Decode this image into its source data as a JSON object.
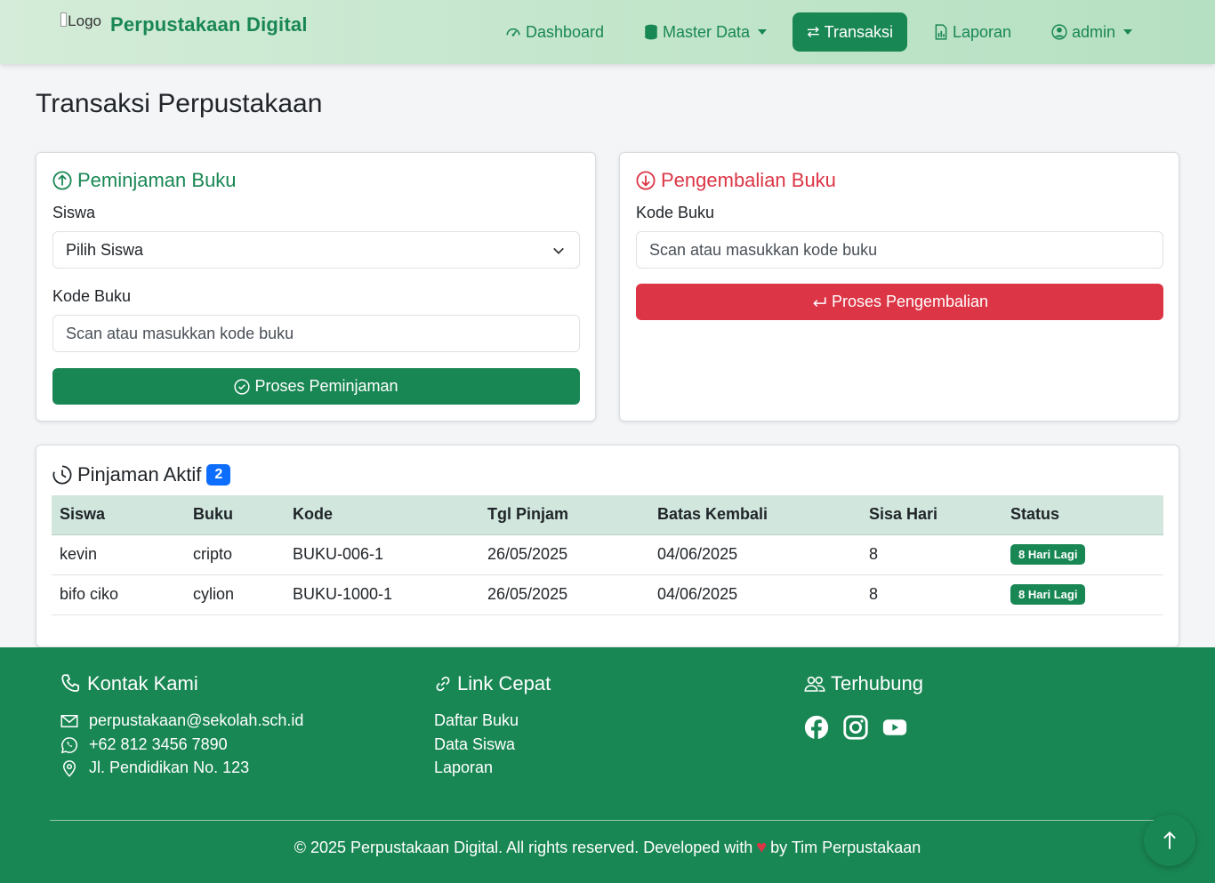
{
  "navbar": {
    "logo_alt": "Logo",
    "brand": "Perpustakaan Digital",
    "items": [
      {
        "label": "Dashboard",
        "icon": "speedometer-icon"
      },
      {
        "label": "Master Data",
        "icon": "database-icon"
      },
      {
        "label": "Transaksi",
        "icon": "arrows-exchange-icon",
        "active": true
      },
      {
        "label": "Laporan",
        "icon": "file-chart-icon"
      },
      {
        "label": "admin",
        "icon": "user-circle-icon"
      }
    ]
  },
  "page": {
    "title": "Transaksi Perpustakaan"
  },
  "borrow": {
    "title": "Peminjaman Buku",
    "student_label": "Siswa",
    "student_value": "Pilih Siswa",
    "code_label": "Kode Buku",
    "code_placeholder": "Scan atau masukkan kode buku",
    "button": "Proses Peminjaman"
  },
  "return": {
    "title": "Pengembalian Buku",
    "code_label": "Kode Buku",
    "code_placeholder": "Scan atau masukkan kode buku",
    "button": "Proses Pengembalian"
  },
  "active_loans": {
    "title": "Pinjaman Aktif",
    "count": "2",
    "headers": [
      "Siswa",
      "Buku",
      "Kode",
      "Tgl Pinjam",
      "Batas Kembali",
      "Sisa Hari",
      "Status"
    ],
    "rows": [
      [
        "kevin",
        "cripto",
        "BUKU-006-1",
        "26/05/2025",
        "04/06/2025",
        "8",
        "8 Hari Lagi"
      ],
      [
        "bifo ciko",
        "cylion",
        "BUKU-1000-1",
        "26/05/2025",
        "04/06/2025",
        "8",
        "8 Hari Lagi"
      ]
    ]
  },
  "footer": {
    "contact": {
      "title": "Kontak Kami",
      "email": "perpustakaan@sekolah.sch.id",
      "phone": "+62 812 3456 7890",
      "address": "Jl. Pendidikan No. 123"
    },
    "links": {
      "title": "Link Cepat",
      "items": [
        "Daftar Buku",
        "Data Siswa",
        "Laporan"
      ]
    },
    "social": {
      "title": "Terhubung",
      "icons": [
        "facebook-icon",
        "instagram-icon",
        "youtube-icon"
      ]
    },
    "copyright_pre": "© 2025 Perpustakaan Digital. All rights reserved. Developed with",
    "copyright_post": "by Tim Perpustakaan"
  },
  "colors": {
    "primary": "#198754",
    "danger": "#dc3545",
    "badge_blue": "#0d6efd"
  }
}
